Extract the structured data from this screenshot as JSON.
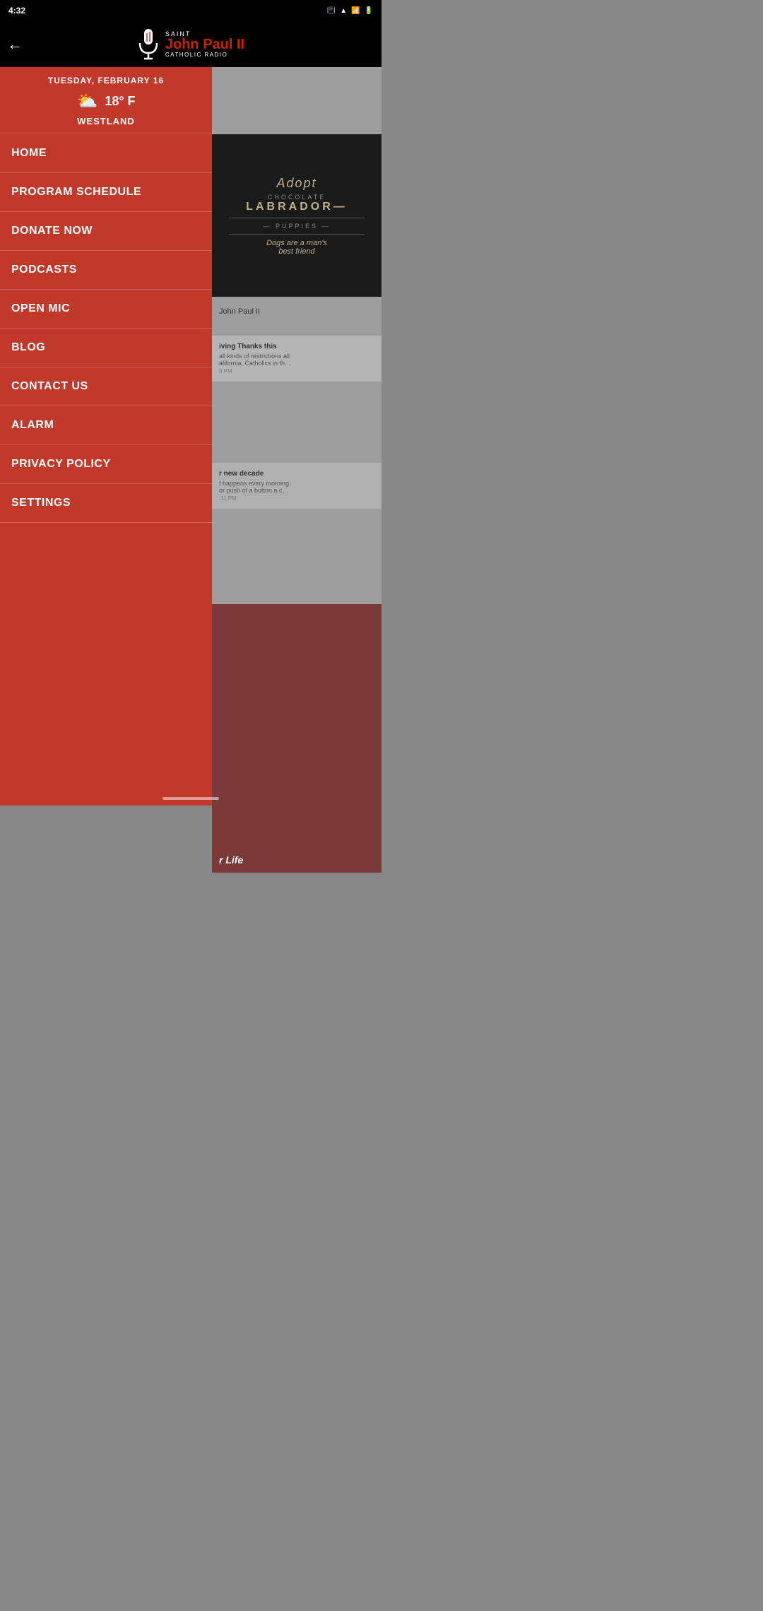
{
  "statusBar": {
    "time": "4:32",
    "icons": [
      "vibrate",
      "wifi",
      "signal",
      "battery"
    ]
  },
  "header": {
    "backLabel": "←",
    "logoSaint": "SAINT",
    "logoName": "John Paul II",
    "logoSubtitle": "CATHOLIC RADIO"
  },
  "weather": {
    "date": "TUESDAY, FEBRUARY 16",
    "temp": "18° F",
    "location": "WESTLAND",
    "icon": "⛅"
  },
  "menu": {
    "items": [
      {
        "label": "HOME",
        "id": "home"
      },
      {
        "label": "PROGRAM SCHEDULE",
        "id": "program-schedule"
      },
      {
        "label": "DONATE NOW",
        "id": "donate-now"
      },
      {
        "label": "PODCASTS",
        "id": "podcasts"
      },
      {
        "label": "OPEN MIC",
        "id": "open-mic"
      },
      {
        "label": "BLOG",
        "id": "blog"
      },
      {
        "label": "CONTACT US",
        "id": "contact-us"
      },
      {
        "label": "ALARM",
        "id": "alarm"
      },
      {
        "label": "PRIVACY POLICY",
        "id": "privacy-policy"
      },
      {
        "label": "SETTINGS",
        "id": "settings"
      }
    ]
  },
  "ad": {
    "line1": "Adopt",
    "line2": "CHOCOLATE",
    "line3": "LABRADOR—",
    "line4": "— PUPPIES —",
    "line5": "Dogs are a man's",
    "line6": "best friend"
  },
  "bgContent": {
    "johnPaulLabel": "John Paul II",
    "story1Title": "iving Thanks this",
    "story1Snippet": "all kinds of restrictions all\nalifornia, Catholics in th…",
    "story1Time": "8 PM",
    "story2Title": "r new decade",
    "story2Snippet": "t happens every morning.\nor push of a button a c…",
    "story2Time": ":11 PM",
    "story3Label": "r Life"
  }
}
